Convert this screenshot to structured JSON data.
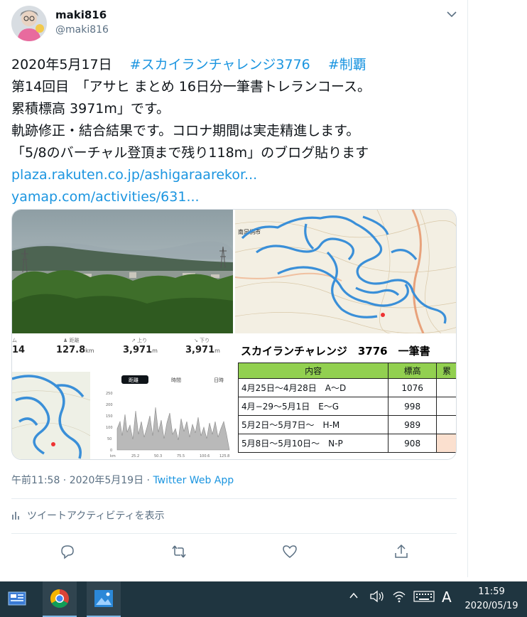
{
  "user": {
    "name": "maki816",
    "handle": "@maki816"
  },
  "tweet": {
    "line1_date": "2020年5月17日",
    "hashtag1": "#スカイランチャレンジ3776",
    "hashtag2": "#制覇",
    "line2": "第14回目　「アサヒ まとめ 16日分一筆書トレランコース。",
    "line3": "累積標高 3971m」です。",
    "line4": "軌跡修正・結合結果です。コロナ期間は実走精進します。",
    "line5": "「5/8のバーチャル登頂まで残り118m」のブログ貼ります",
    "link1": "plaza.rakuten.co.jp/ashigaraarekor...",
    "link2": "yamap.com/activities/631..."
  },
  "media": {
    "map_town_label": "南足柄市",
    "stats": [
      {
        "label": "ム",
        "value": "14",
        "unit": ""
      },
      {
        "label": "距離",
        "value": "127.8",
        "unit": "km"
      },
      {
        "label": "上り",
        "value": "3,971",
        "unit": "m"
      },
      {
        "label": "下り",
        "value": "3,971",
        "unit": "m"
      }
    ],
    "chart_tabs": [
      "距離",
      "時間",
      "日時"
    ],
    "chart_y_ticks": [
      "250",
      "200",
      "150",
      "100",
      "50",
      "0"
    ],
    "chart_x_ticks": [
      "km",
      "25.2",
      "50.3",
      "75.5",
      "100.6",
      "125.8"
    ],
    "table_title": "スカイランチャレンジ　3776　一筆書",
    "table_headers": [
      "内容",
      "標高",
      "累"
    ],
    "table_rows": [
      {
        "period": "4月25日〜4月28日　A〜D",
        "elev": "1076"
      },
      {
        "period": "4月−29〜5月1日　E〜G",
        "elev": "998"
      },
      {
        "period": "5月2日〜5月7日〜　H-M",
        "elev": "989"
      },
      {
        "period": "5月8日〜5月10日〜　N-P",
        "elev": "908"
      }
    ]
  },
  "meta": {
    "time": "午前11:58",
    "date": "2020年5月19日",
    "app": "Twitter Web App"
  },
  "activity_label": "ツイートアクティビティを表示",
  "taskbar": {
    "ime": "A",
    "time": "11:59",
    "date": "2020/05/19"
  },
  "colors": {
    "link": "#1b95e0",
    "route": "#3a8fd8",
    "table_header": "#92d050",
    "taskbar": "#1f3540"
  }
}
